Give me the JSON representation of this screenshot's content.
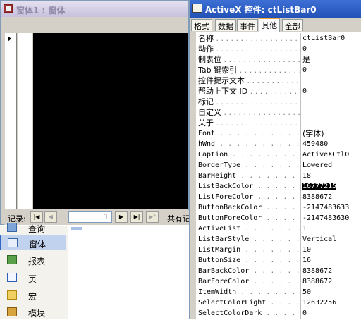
{
  "form_window": {
    "title": "窗体1 : 窗体",
    "record_label": "记录:",
    "record_number": "1",
    "total_label": "共有记",
    "nav": {
      "first": "|◀",
      "prev": "◀",
      "next": "▶",
      "last": "▶|",
      "new": "▶*"
    }
  },
  "object_list": {
    "items": [
      {
        "label": "查询",
        "icon": "query-icon"
      },
      {
        "label": "窗体",
        "icon": "form-icon"
      },
      {
        "label": "报表",
        "icon": "report-icon"
      },
      {
        "label": "页",
        "icon": "page-icon"
      },
      {
        "label": "宏",
        "icon": "macro-icon"
      },
      {
        "label": "模块",
        "icon": "module-icon"
      }
    ],
    "selected": "窗体"
  },
  "property_sheet": {
    "title": "ActiveX 控件: ctListBar0",
    "tabs": [
      "格式",
      "数据",
      "事件",
      "其他",
      "全部"
    ],
    "active_tab": "其他",
    "rows": [
      {
        "name": "名称",
        "value": "ctListBar0"
      },
      {
        "name": "动作",
        "value": "0"
      },
      {
        "name": "制表位",
        "value": "是"
      },
      {
        "name": "Tab 键索引",
        "value": "0"
      },
      {
        "name": "控件提示文本",
        "value": ""
      },
      {
        "name": "帮助上下文 ID",
        "value": "0"
      },
      {
        "name": "标记",
        "value": ""
      },
      {
        "name": "自定义",
        "value": ""
      },
      {
        "name": "关于",
        "value": ""
      },
      {
        "name": "Font",
        "value": "(字体)"
      },
      {
        "name": "hWnd",
        "value": "459480"
      },
      {
        "name": "Caption",
        "value": "ActiveXCtl0"
      },
      {
        "name": "BorderType",
        "value": "Lowered"
      },
      {
        "name": "BarHeight",
        "value": "18"
      },
      {
        "name": "ListBackColor",
        "value": "16777215"
      },
      {
        "name": "ListForeColor",
        "value": "8388672"
      },
      {
        "name": "ButtonBackColor",
        "value": "-2147483633"
      },
      {
        "name": "ButtonForeColor",
        "value": "-2147483630"
      },
      {
        "name": "ActiveList",
        "value": "1"
      },
      {
        "name": "ListBarStyle",
        "value": "Vertical"
      },
      {
        "name": "ListMargin",
        "value": "10"
      },
      {
        "name": "ButtonSize",
        "value": "16"
      },
      {
        "name": "BarBackColor",
        "value": "8388672"
      },
      {
        "name": "BarForeColor",
        "value": "8388672"
      },
      {
        "name": "ItemWidth",
        "value": "50"
      },
      {
        "name": "SelectColorLight",
        "value": "12632256"
      },
      {
        "name": "SelectColorDark",
        "value": "0"
      }
    ],
    "highlighted_row": "ListBackColor"
  },
  "colors": {
    "title_active": "#2352b7",
    "title_inactive": "#c7c0dd",
    "tab_accent": "#f5a637",
    "selection": "#316ac5"
  }
}
